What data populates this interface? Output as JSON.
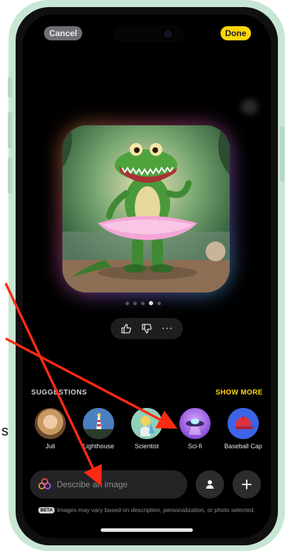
{
  "header": {
    "cancel_label": "Cancel",
    "done_label": "Done"
  },
  "preview": {
    "page_count": 5,
    "active_page_index": 3
  },
  "feedback": {
    "thumbs_up_icon": "thumbs-up-icon",
    "thumbs_down_icon": "thumbs-down-icon",
    "more_label": "···"
  },
  "suggestions": {
    "title": "SUGGESTIONS",
    "show_more_label": "SHOW MORE",
    "items": [
      {
        "label": "Juli"
      },
      {
        "label": "Lighthouse"
      },
      {
        "label": "Scientist"
      },
      {
        "label": "Sci-fi"
      },
      {
        "label": "Baseball Cap"
      }
    ]
  },
  "prompt": {
    "placeholder": "Describe an image"
  },
  "disclaimer": {
    "badge": "BETA",
    "text": "Images may vary based on description, personalization, or photo selected."
  },
  "edge_text": "s",
  "colors": {
    "accent_yellow": "#ffd60a",
    "annotation_red": "#ff2a12",
    "frame_green": "#c7e6d4"
  }
}
